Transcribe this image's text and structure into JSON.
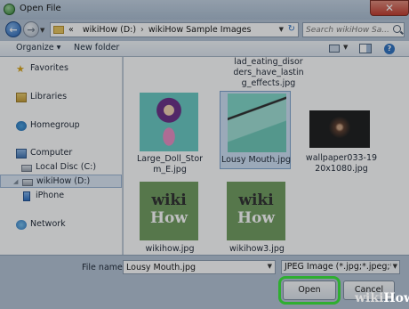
{
  "window": {
    "title": "Open File",
    "close_glyph": "✕"
  },
  "address": {
    "crumbs": [
      "«",
      "wikiHow (D:)",
      "›",
      "wikiHow Sample Images"
    ],
    "search_placeholder": "Search wikiHow Sa..."
  },
  "toolbar": {
    "organize": "Organize ▾",
    "new_folder": "New folder",
    "help": "?"
  },
  "nav": {
    "favorites": "Favorites",
    "libraries": "Libraries",
    "homegroup": "Homegroup",
    "computer": "Computer",
    "local_disc": "Local Disc (C:)",
    "wikihow_drive": "wikiHow (D:)",
    "iphone": "iPhone",
    "network": "Network"
  },
  "files": {
    "top_partial": "lad_eating_disor\nders_have_lastin\ng_effects.jpg",
    "items": [
      {
        "name": "Large_Doll_Stor\nm_E.jpg",
        "icon": "doll-thumbnail"
      },
      {
        "name": "Lousy Mouth.jpg",
        "icon": "mouth-thumbnail",
        "selected": true
      },
      {
        "name": "wallpaper033-19\n20x1080.jpg",
        "icon": "wallpaper-thumbnail"
      },
      {
        "name": "wikihow.jpg",
        "icon": "wikihow-thumbnail",
        "thumb_line1": "wiki",
        "thumb_line2": "How"
      },
      {
        "name": "wikihow3.jpg",
        "icon": "wikihow-thumbnail",
        "thumb_line1": "wiki",
        "thumb_line2": "How"
      }
    ]
  },
  "bottom": {
    "file_name_label": "File name:",
    "file_name_value": "Lousy Mouth.jpg",
    "file_type_value": "JPEG Image (*.jpg;*.jpeg;*.",
    "open_label": "Open",
    "cancel_label": "Cancel"
  },
  "watermark": {
    "part1": "wiki",
    "part2": "How"
  },
  "colors": {
    "highlight": "#39e83a",
    "selection": "#cfe1f5",
    "chrome": "#b3c3d5"
  }
}
